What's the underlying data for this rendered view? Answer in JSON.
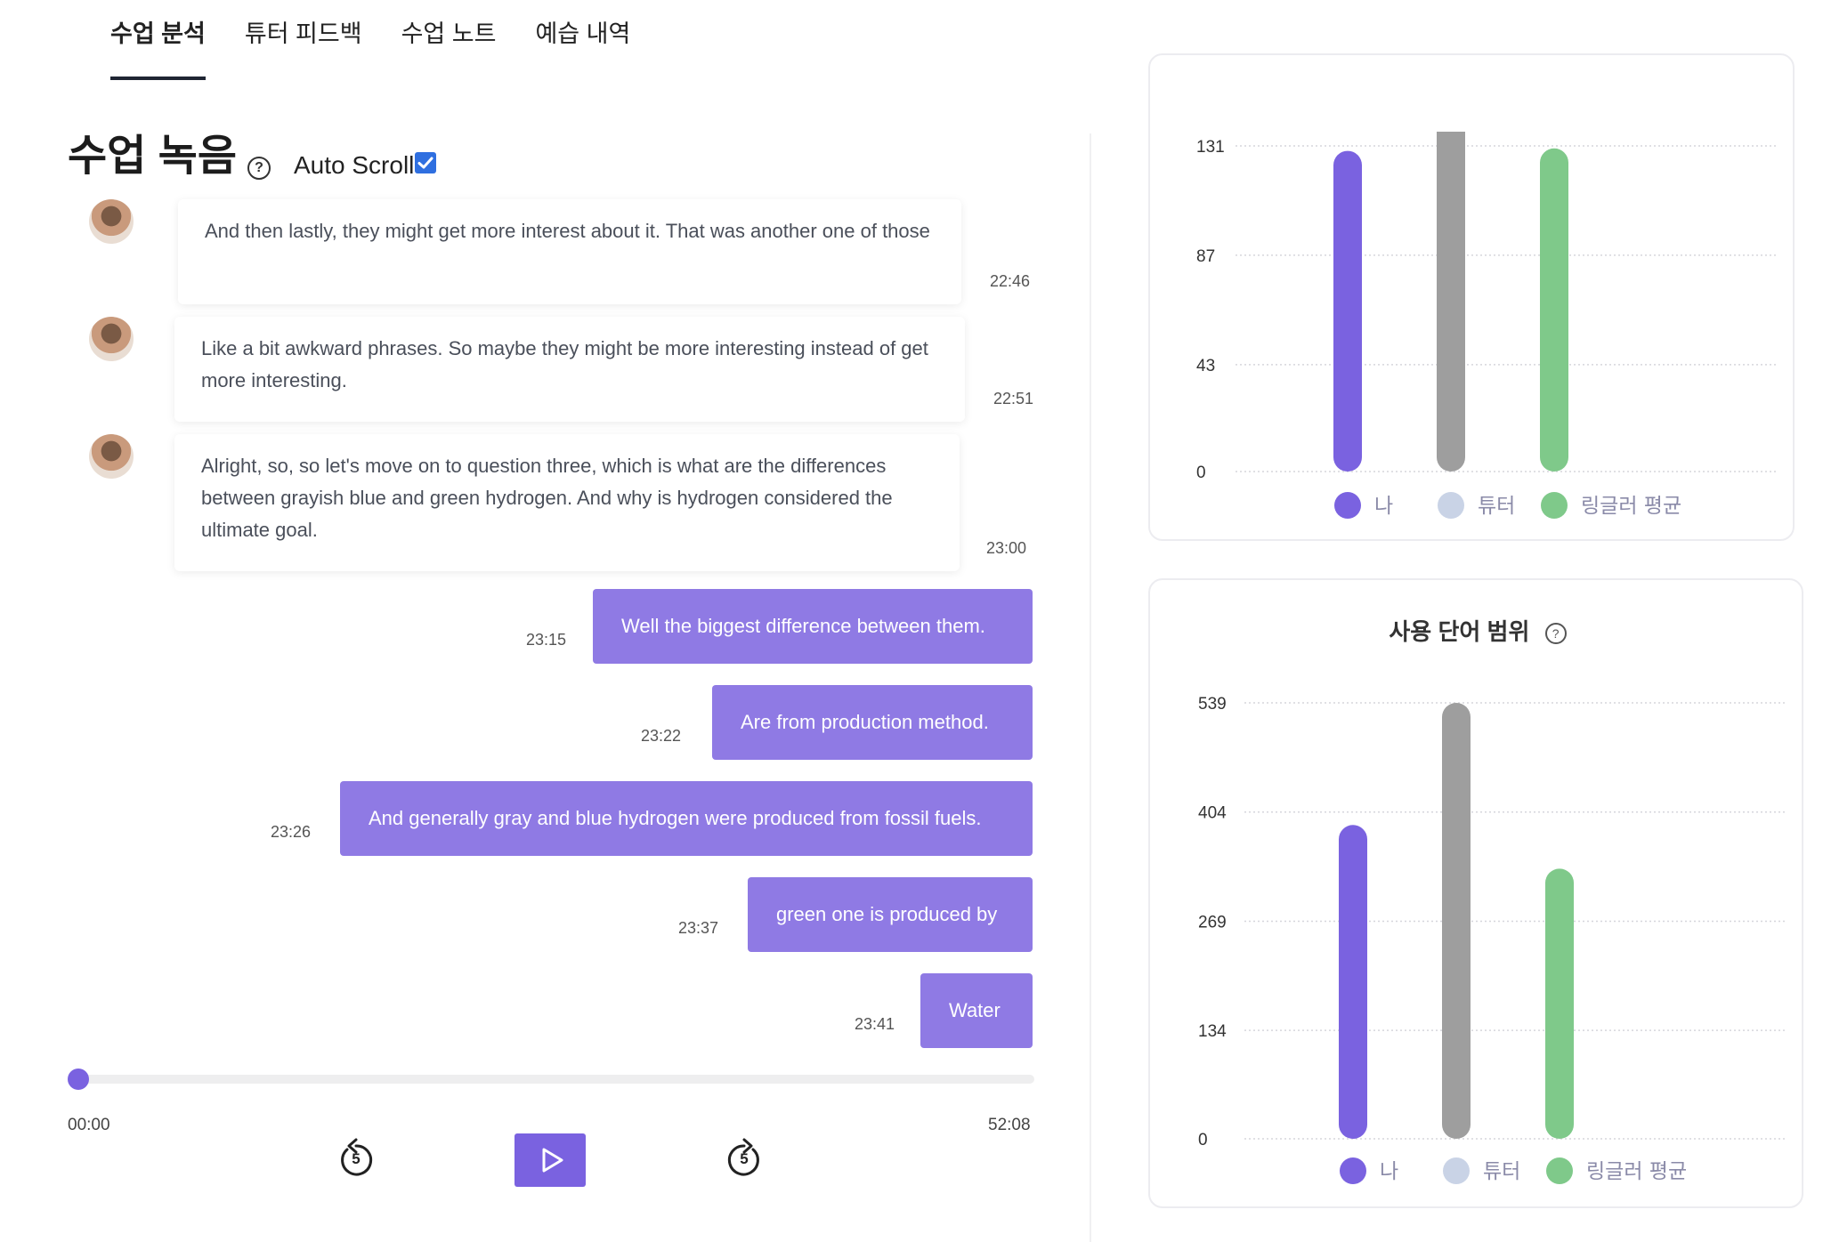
{
  "tabs": [
    "수업 분석",
    "튜터 피드백",
    "수업 노트",
    "예습 내역"
  ],
  "active_tab": "수업 분석",
  "section": {
    "title": "수업 녹음",
    "help_icon": "?",
    "auto_scroll_label": "Auto Scroll",
    "auto_scroll_checked": true
  },
  "tutor_messages": [
    {
      "text": "And then lastly, they might get more interest about it. That was another one of those",
      "time": "22:46"
    },
    {
      "text": "Like a bit awkward phrases. So maybe they might be more interesting instead of get more interesting.",
      "time": "22:51"
    },
    {
      "text": "Alright, so, so let's move on to question three, which is what are the differences between grayish blue and green hydrogen. And why is hydrogen considered the ultimate goal.",
      "time": "23:00"
    }
  ],
  "my_messages": [
    {
      "text": "Well the biggest difference between them.",
      "time": "23:15"
    },
    {
      "text": "Are from production method.",
      "time": "23:22"
    },
    {
      "text": "And generally gray and blue hydrogen were produced from fossil fuels.",
      "time": "23:26"
    },
    {
      "text": "green one is produced by",
      "time": "23:37"
    },
    {
      "text": "Water",
      "time": "23:41"
    }
  ],
  "player": {
    "current_time": "00:00",
    "total_time": "52:08",
    "progress": 0,
    "rewind_label": "5",
    "forward_label": "5"
  },
  "colors": {
    "accent": "#7a62e0",
    "me": "#7a62e0",
    "tutor": "#9e9e9e",
    "avg": "#7fc98a",
    "tutor_legend": "#c9d3e6",
    "my_bubble": "#8f7ae4"
  },
  "chart_data": [
    {
      "type": "bar",
      "title": "",
      "categories": [
        "나",
        "튜터",
        "링글러 평균"
      ],
      "values": [
        129,
        137,
        130
      ],
      "yticks": [
        0,
        43,
        87,
        131
      ],
      "ylim": [
        0,
        131
      ],
      "legend": [
        "나",
        "튜터",
        "링글러 평균"
      ],
      "legend_placement": "bottom",
      "grid": true
    },
    {
      "type": "bar",
      "title": "사용 단어 범위",
      "categories": [
        "나",
        "튜터",
        "링글러 평균"
      ],
      "values": [
        388,
        539,
        334
      ],
      "yticks": [
        0,
        134,
        269,
        404,
        539
      ],
      "ylim": [
        0,
        539
      ],
      "legend": [
        "나",
        "튜터",
        "링글러 평균"
      ],
      "legend_placement": "bottom",
      "grid": true
    }
  ]
}
